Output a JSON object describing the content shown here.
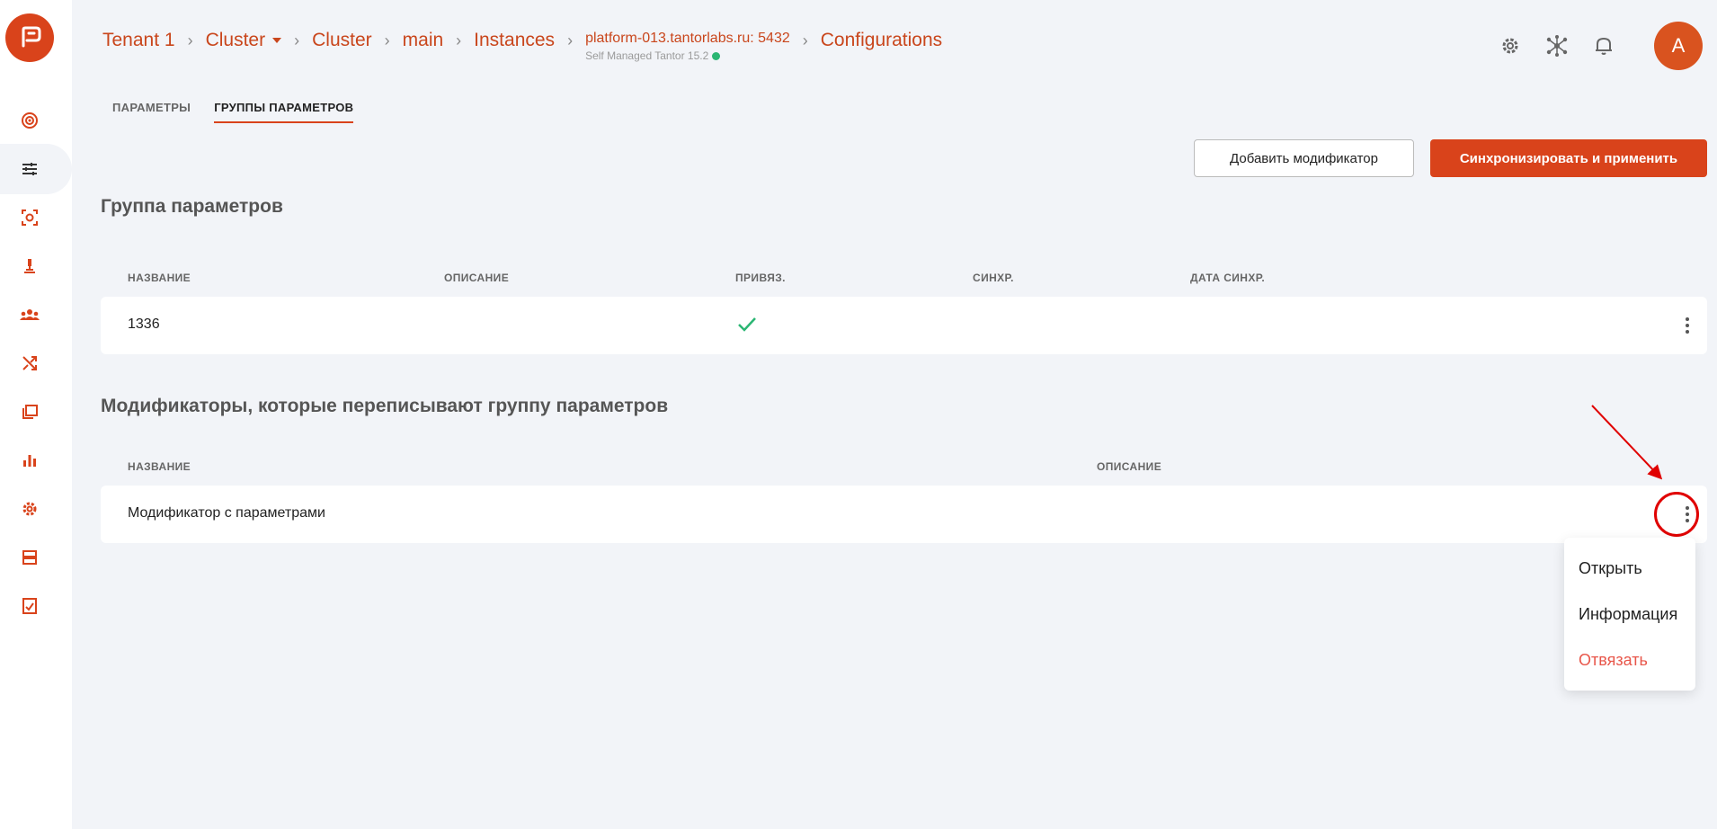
{
  "breadcrumb": {
    "tenant": "Tenant 1",
    "cluster_dropdown": "Cluster",
    "cluster": "Cluster",
    "main": "main",
    "instances": "Instances",
    "host": "platform-013.tantorlabs.ru: 5432",
    "host_sub": "Self Managed Tantor 15.2",
    "configurations": "Configurations"
  },
  "avatar_letter": "A",
  "tabs": [
    {
      "label": "ПАРАМЕТРЫ",
      "active": false
    },
    {
      "label": "ГРУППЫ ПАРАМЕТРОВ",
      "active": true
    }
  ],
  "buttons": {
    "add_modifier": "Добавить модификатор",
    "sync_apply": "Синхронизировать и применить"
  },
  "param_group": {
    "title": "Группа параметров",
    "columns": [
      "НАЗВАНИЕ",
      "ОПИСАНИЕ",
      "ПРИВЯЗ.",
      "СИНХР.",
      "ДАТА СИНХР."
    ],
    "row": {
      "name": "1336",
      "description": "",
      "bound": true,
      "sync": "",
      "sync_date": ""
    }
  },
  "modifiers": {
    "title": "Модификаторы, которые переписывают группу параметров",
    "columns": [
      "НАЗВАНИЕ",
      "ОПИСАНИЕ"
    ],
    "row": {
      "name": "Модификатор с параметрами",
      "description": ""
    }
  },
  "context_menu": {
    "open": "Открыть",
    "info": "Информация",
    "unbind": "Отвязать"
  },
  "colors": {
    "brand": "#d9431b",
    "ok": "#2bb673",
    "danger": "#e8564a",
    "annotation": "#e00000"
  }
}
